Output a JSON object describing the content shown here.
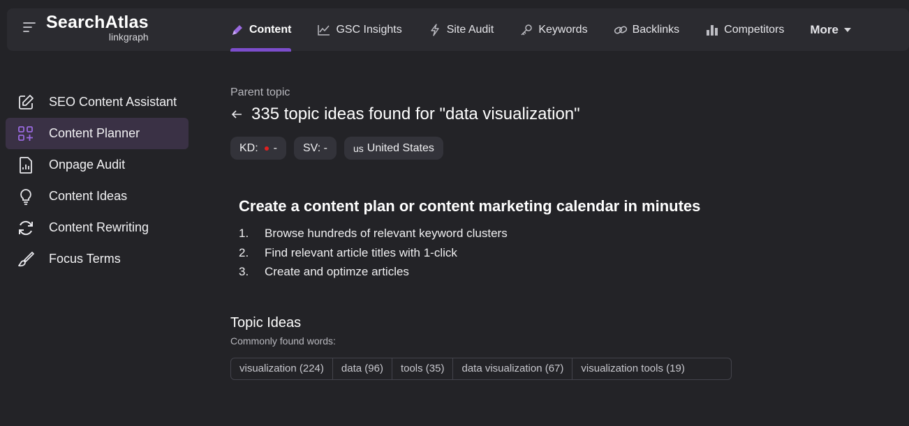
{
  "brand": {
    "name": "SearchAtlas",
    "sub": "linkgraph"
  },
  "nav": {
    "items": [
      {
        "label": "Content",
        "icon": "pen-icon"
      },
      {
        "label": "GSC Insights",
        "icon": "trend-icon"
      },
      {
        "label": "Site Audit",
        "icon": "bolt-icon"
      },
      {
        "label": "Keywords",
        "icon": "key-icon"
      },
      {
        "label": "Backlinks",
        "icon": "link-icon"
      },
      {
        "label": "Competitors",
        "icon": "bars-icon"
      }
    ],
    "more_label": "More",
    "accent": "#7c4dcc"
  },
  "sidebar": {
    "items": [
      {
        "label": "SEO Content Assistant",
        "icon": "edit-icon"
      },
      {
        "label": "Content Planner",
        "icon": "grid-plus-icon"
      },
      {
        "label": "Onpage Audit",
        "icon": "report-icon"
      },
      {
        "label": "Content Ideas",
        "icon": "lightbulb-icon"
      },
      {
        "label": "Content Rewriting",
        "icon": "refresh-icon"
      },
      {
        "label": "Focus Terms",
        "icon": "brush-icon"
      }
    ]
  },
  "main": {
    "parent_topic": "Parent topic",
    "heading": "335 topic ideas found for \"data visualization\"",
    "chips": {
      "kd_label": "KD:",
      "kd_value": "-",
      "kd_dot_color": "#e02020",
      "sv_label": "SV:",
      "sv_value": "-",
      "country_flag": "us",
      "country": "United States"
    },
    "plan": {
      "title": "Create a content plan or content marketing calendar in minutes",
      "steps": [
        {
          "num": "1.",
          "text": "Browse hundreds of relevant keyword clusters"
        },
        {
          "num": "2.",
          "text": "Find relevant article titles with 1-click"
        },
        {
          "num": "3.",
          "text": "Create and optimze articles"
        }
      ]
    },
    "topics": {
      "title": "Topic Ideas",
      "subtitle": "Commonly found words:",
      "words": [
        "visualization (224)",
        "data (96)",
        "tools (35)",
        "data visualization (67)",
        "visualization tools (19)"
      ]
    }
  }
}
